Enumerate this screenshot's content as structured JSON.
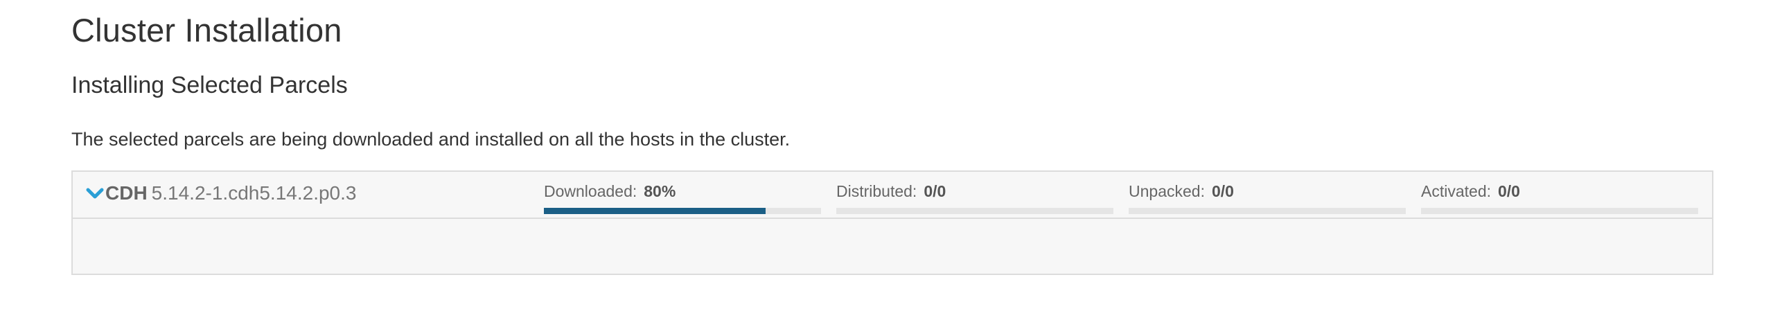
{
  "page": {
    "title": "Cluster Installation",
    "section_title": "Installing Selected Parcels",
    "description": "The selected parcels are being downloaded and installed on all the hosts in the cluster."
  },
  "parcel": {
    "product": "CDH",
    "version": "5.14.2-1.cdh5.14.2.p0.3",
    "toggle_icon": "chevron-down-icon",
    "stages": [
      {
        "label": "Downloaded:",
        "value": "80%",
        "progress": 0.8
      },
      {
        "label": "Distributed:",
        "value": "0/0",
        "progress": 0
      },
      {
        "label": "Unpacked:",
        "value": "0/0",
        "progress": 0
      },
      {
        "label": "Activated:",
        "value": "0/0",
        "progress": 0
      }
    ]
  },
  "colors": {
    "progress_fill": "#1b5f86",
    "progress_track": "#e5e5e5",
    "chevron": "#2a9fd6",
    "panel_bg": "#f7f7f7",
    "panel_border": "#dcdcdc"
  }
}
